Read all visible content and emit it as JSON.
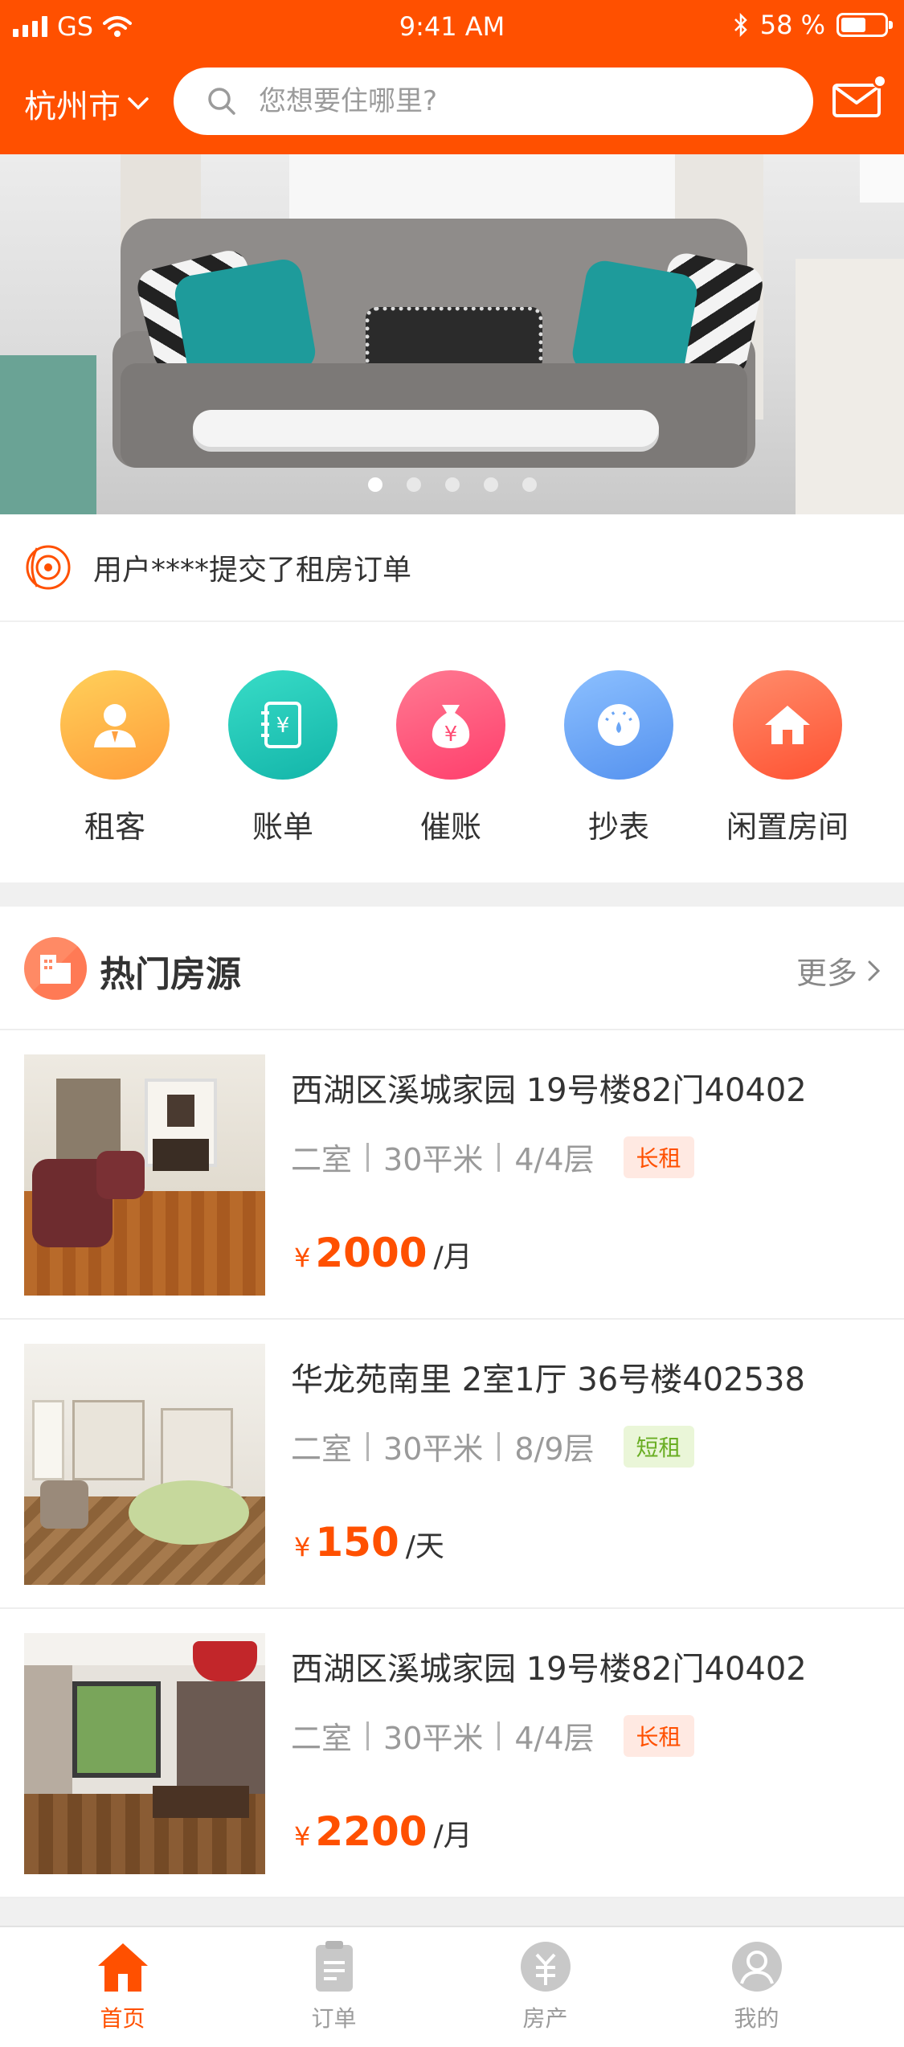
{
  "status_bar": {
    "carrier": "GS",
    "time": "9:41 AM",
    "battery": "58 %"
  },
  "header": {
    "city": "杭州市",
    "search_placeholder": "您想要住哪里?"
  },
  "banner": {
    "slide_count": 5,
    "active_slide": 1
  },
  "notice": {
    "text": "用户****提交了租房订单"
  },
  "quick_nav": [
    {
      "label": "租客",
      "icon": "tenant-icon",
      "color": "#ffb84a"
    },
    {
      "label": "账单",
      "icon": "bill-icon",
      "color": "#22c7b8"
    },
    {
      "label": "催账",
      "icon": "money-bag-icon",
      "color": "#ff5c7c"
    },
    {
      "label": "抄表",
      "icon": "meter-icon",
      "color": "#6aa5f5"
    },
    {
      "label": "闲置房间",
      "icon": "house-icon",
      "color": "#ff6a45"
    }
  ],
  "hot": {
    "title": "热门房源",
    "more_label": "更多",
    "listings": [
      {
        "title": "西湖区溪城家园 19号楼82门40402",
        "rooms": "二室",
        "area": "30平米",
        "floor": "4/4层",
        "tag": "长租",
        "currency": "¥",
        "price": "2000",
        "unit": "/月"
      },
      {
        "title": "华龙苑南里 2室1厅 36号楼402538",
        "rooms": "二室",
        "area": "30平米",
        "floor": "8/9层",
        "tag": "短租",
        "currency": "¥",
        "price": "150",
        "unit": "/天"
      },
      {
        "title": "西湖区溪城家园 19号楼82门40402",
        "rooms": "二室",
        "area": "30平米",
        "floor": "4/4层",
        "tag": "长租",
        "currency": "¥",
        "price": "2200",
        "unit": "/月"
      }
    ]
  },
  "tabbar": [
    {
      "label": "首页",
      "icon": "home-icon",
      "active": true
    },
    {
      "label": "订单",
      "icon": "order-icon",
      "active": false
    },
    {
      "label": "房产",
      "icon": "property-icon",
      "active": false
    },
    {
      "label": "我的",
      "icon": "profile-icon",
      "active": false
    }
  ],
  "colors": {
    "brand": "#ff5000",
    "long_tag": "#ff5000",
    "short_tag": "#6aae24"
  }
}
